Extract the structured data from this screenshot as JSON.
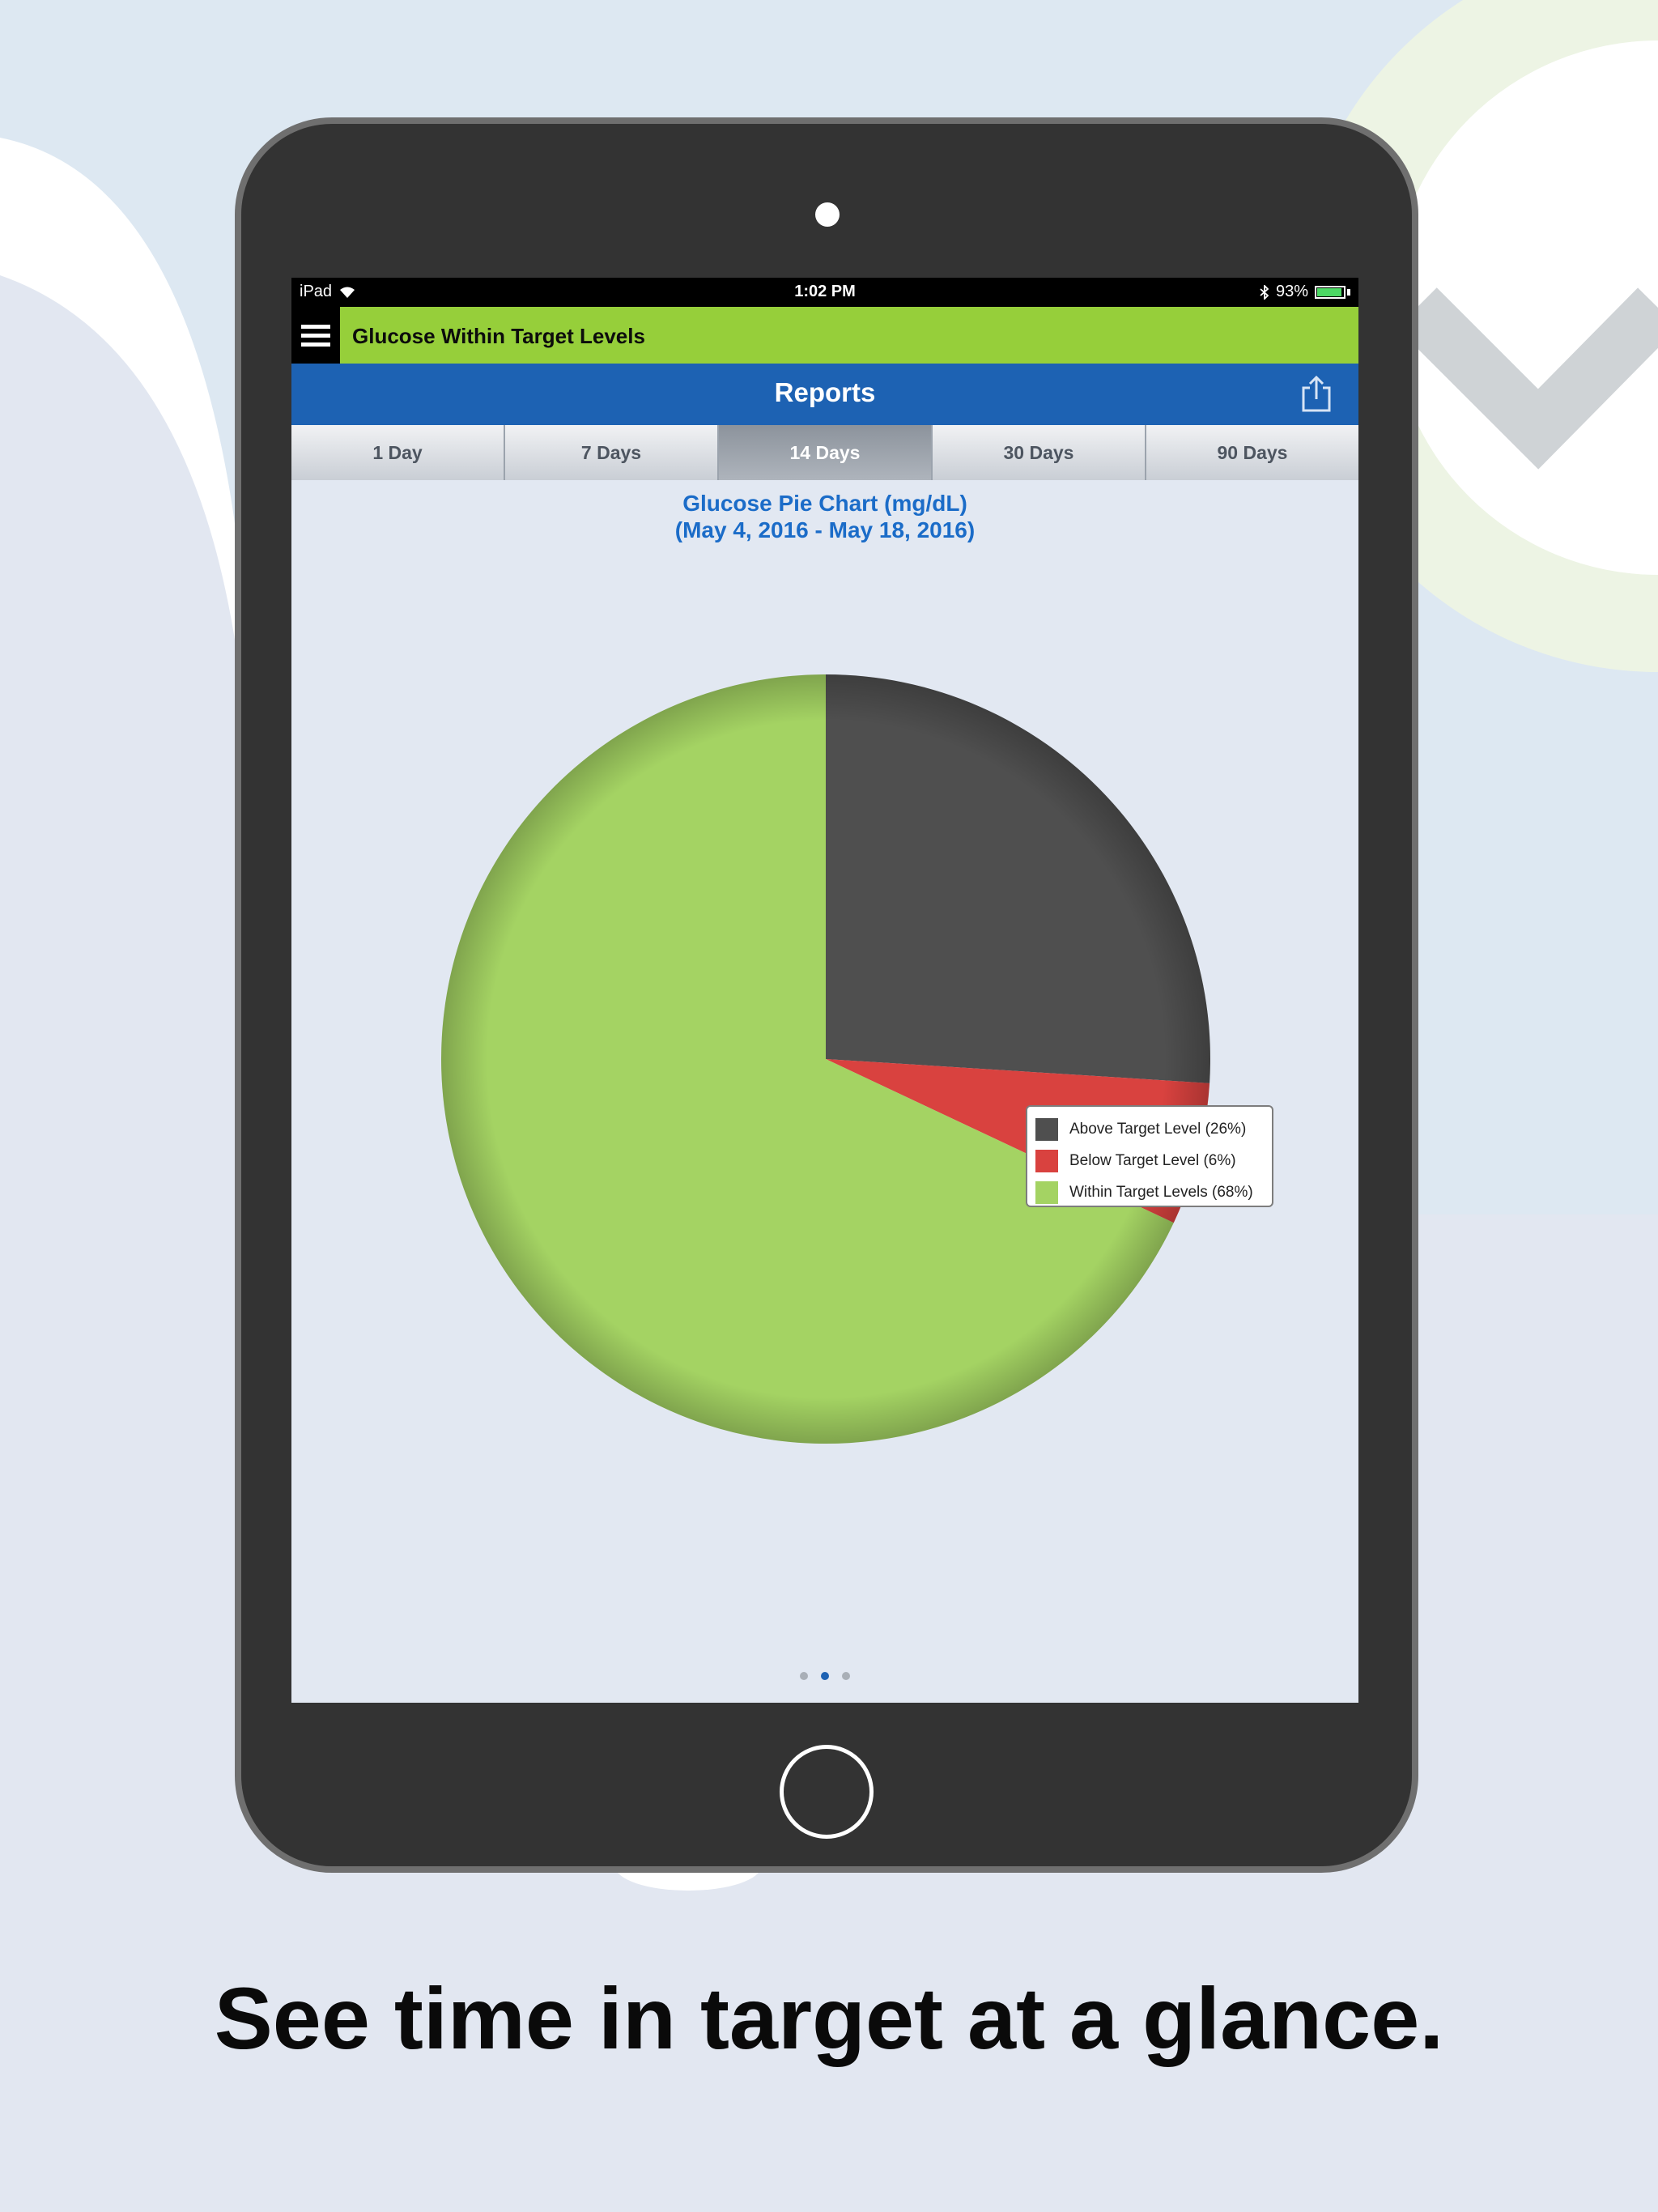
{
  "status_bar": {
    "device": "iPad",
    "time": "1:02 PM",
    "battery": "93%",
    "battery_level": 0.93
  },
  "app_bar": {
    "title": "Glucose Within Target Levels"
  },
  "nav_bar": {
    "title": "Reports"
  },
  "tabs": [
    {
      "label": "1 Day",
      "active": false
    },
    {
      "label": "7 Days",
      "active": false
    },
    {
      "label": "14 Days",
      "active": true
    },
    {
      "label": "30 Days",
      "active": false
    },
    {
      "label": "90 Days",
      "active": false
    }
  ],
  "chart_data": {
    "type": "pie",
    "title": "Glucose Pie Chart (mg/dL)",
    "subtitle": "(May 4, 2016 - May 18, 2016)",
    "slices": [
      {
        "label": "Above Target Level (26%)",
        "value": 26,
        "color": "#4f4f4f"
      },
      {
        "label": "Below Target Level (6%)",
        "value": 6,
        "color": "#d9423f"
      },
      {
        "label": "Within Target Levels (68%)",
        "value": 68,
        "color": "#a4d363"
      }
    ],
    "legend_position": "right"
  },
  "page_indicator": {
    "count": 3,
    "current": 2
  },
  "caption": "See time in target at a glance.",
  "colors": {
    "app_bar": "#96cf3a",
    "nav_bar": "#1d62b3",
    "chart_title": "#1b6cc8"
  }
}
